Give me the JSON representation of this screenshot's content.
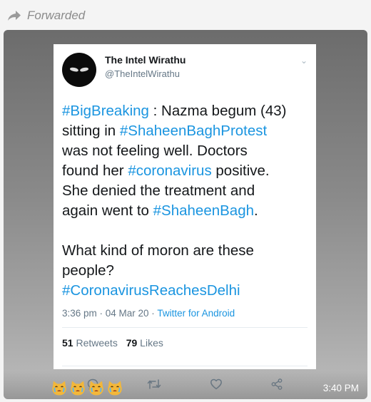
{
  "forwarded": {
    "label": "Forwarded",
    "icon": "forward-arrow-icon"
  },
  "tweet": {
    "display_name": "The Intel Wirathu",
    "handle": "@TheIntelWirathu",
    "text": {
      "l1_tag": "#BigBreaking",
      "l1_rest": " : Nazma begum (43)",
      "l2_pre": "sitting in ",
      "l2_tag": "#ShaheenBaghProtest",
      "l3": "was not feeling well. Doctors",
      "l4_pre": "found her ",
      "l4_tag": "#coronavirus",
      "l4_post": " positive.",
      "l5": "She denied the treatment and",
      "l6_pre": "again went to ",
      "l6_tag": "#ShaheenBagh",
      "l6_post": ".",
      "l7": "What kind of moron are these",
      "l8": "people?",
      "l9_tag": "#CoronavirusReachesDelhi"
    },
    "meta": {
      "time_date": "3:36 pm · 04 Mar 20 · ",
      "client": "Twitter for Android"
    },
    "stats": {
      "retweets_count": "51",
      "retweets_label": " Retweets",
      "likes_count": "79",
      "likes_label": " Likes"
    },
    "actions": [
      "reply-icon",
      "retweet-icon",
      "like-icon",
      "share-icon"
    ]
  },
  "message": {
    "time": "3:40 PM",
    "emoji_count": 4,
    "emoji_icon": "crying-cat-face-icon"
  },
  "colors": {
    "hashtag": "#1b95e0",
    "muted": "#657786",
    "forward_label": "#8b8b8b"
  }
}
